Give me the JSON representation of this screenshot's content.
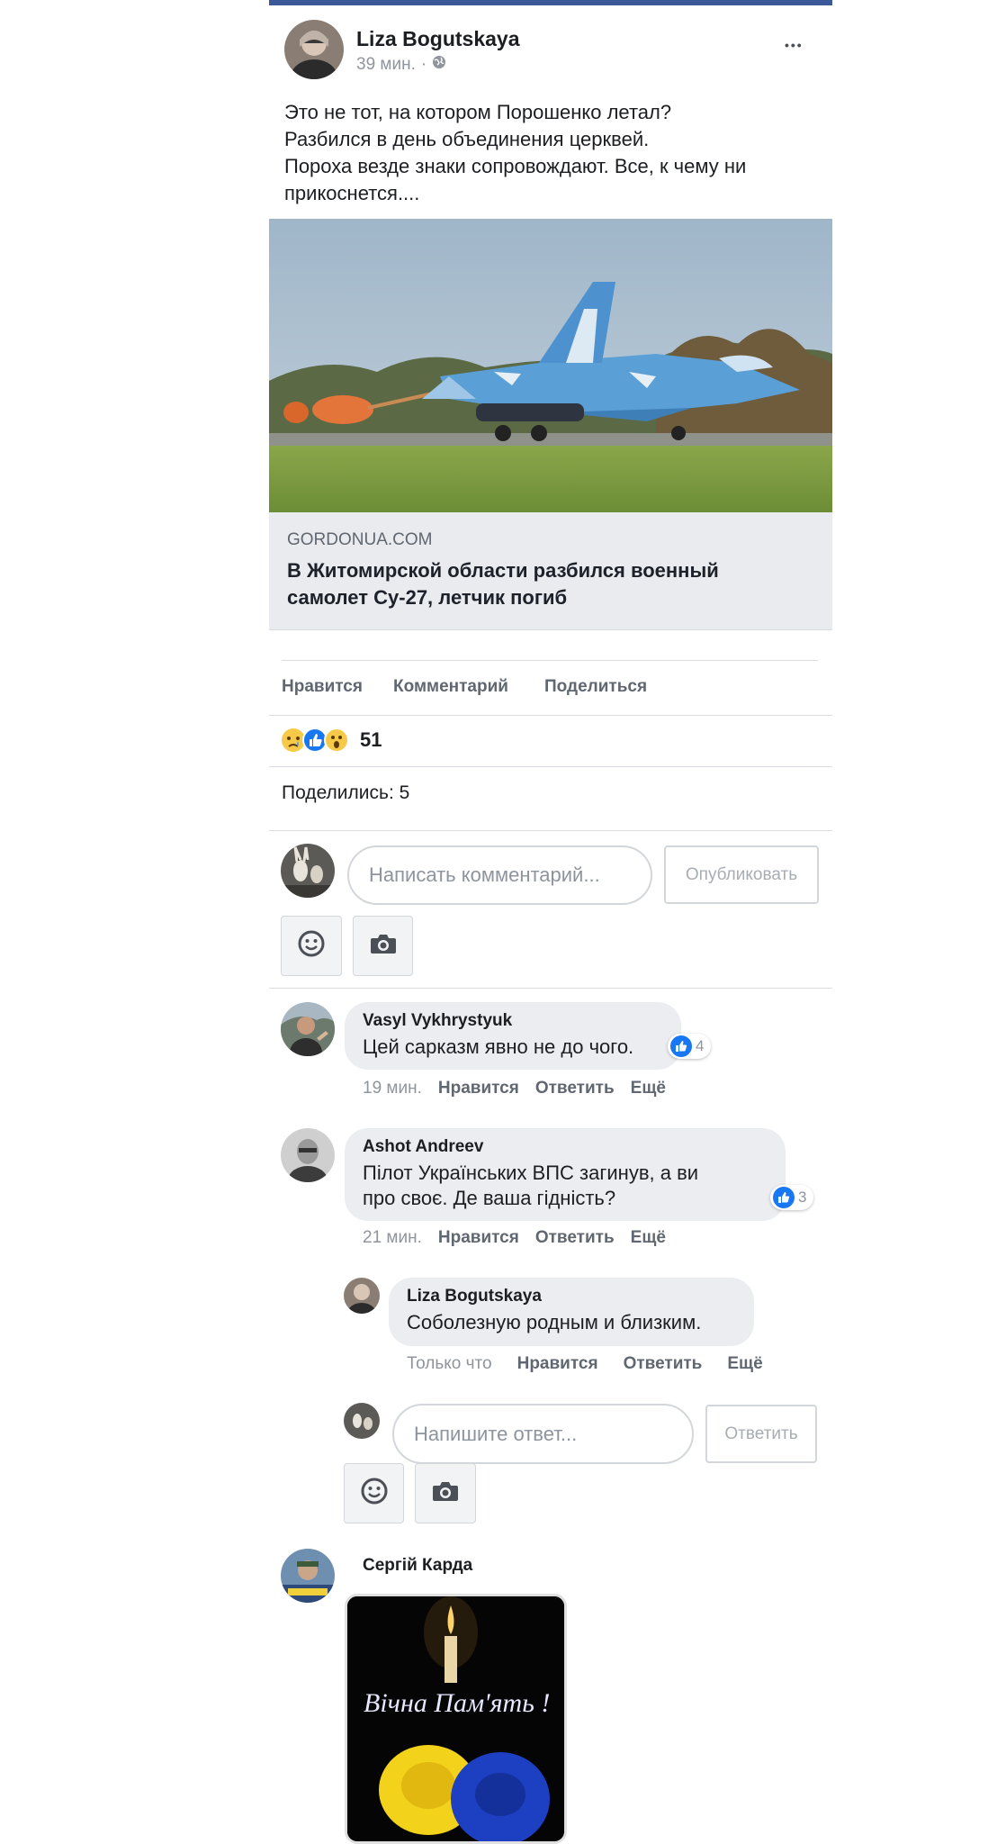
{
  "post": {
    "author": "Liza Bogutskaya",
    "time": "39 мин.",
    "dot": "·",
    "more": "•••",
    "text_lines": [
      "Это не тот, на котором Порошенко летал?",
      "Разбился в день объединения церквей.",
      "Пороха везде знаки сопровождают. Все, к чему ни",
      "прикоснется...."
    ],
    "link": {
      "domain": "GORDONUA.COM",
      "headline_lines": [
        "В Житомирской области разбился военный",
        "самолет Су-27, летчик погиб"
      ]
    },
    "actions": {
      "like": "Нравится",
      "comment": "Комментарий",
      "share": "Поделиться"
    },
    "reactions": {
      "count": "51",
      "icons": [
        "sad",
        "like",
        "wow"
      ]
    },
    "shares": "Поделились: 5"
  },
  "composer": {
    "placeholder": "Написать комментарий...",
    "publish": "Опубликовать"
  },
  "comments": [
    {
      "author": "Vasyl Vykhrystyuk",
      "text_lines": [
        "Цей сарказм явно не до чого."
      ],
      "likes": "4",
      "time": "19 мин.",
      "like": "Нравится",
      "reply": "Ответить",
      "more": "Ещё"
    },
    {
      "author": "Ashot Andreev",
      "text_lines": [
        "Пілот Українських ВПС загинув, а ви",
        "про своє. Де ваша гідність?"
      ],
      "likes": "3",
      "time": "21 мин.",
      "like": "Нравится",
      "reply": "Ответить",
      "more": "Ещё"
    },
    {
      "author": "Сергій Карда",
      "sticker_text": "Вічна Пам'ять !"
    }
  ],
  "reply": {
    "author": "Liza Bogutskaya",
    "text": "Соболезную родным и близким.",
    "time": "Только что",
    "like": "Нравится",
    "reply": "Ответить",
    "more": "Ещё"
  },
  "reply_composer": {
    "placeholder": "Напишите ответ...",
    "button": "Ответить"
  },
  "colors": {
    "brand": "#3b5998",
    "like_blue": "#1877f2",
    "bubble": "#ebedf0"
  }
}
